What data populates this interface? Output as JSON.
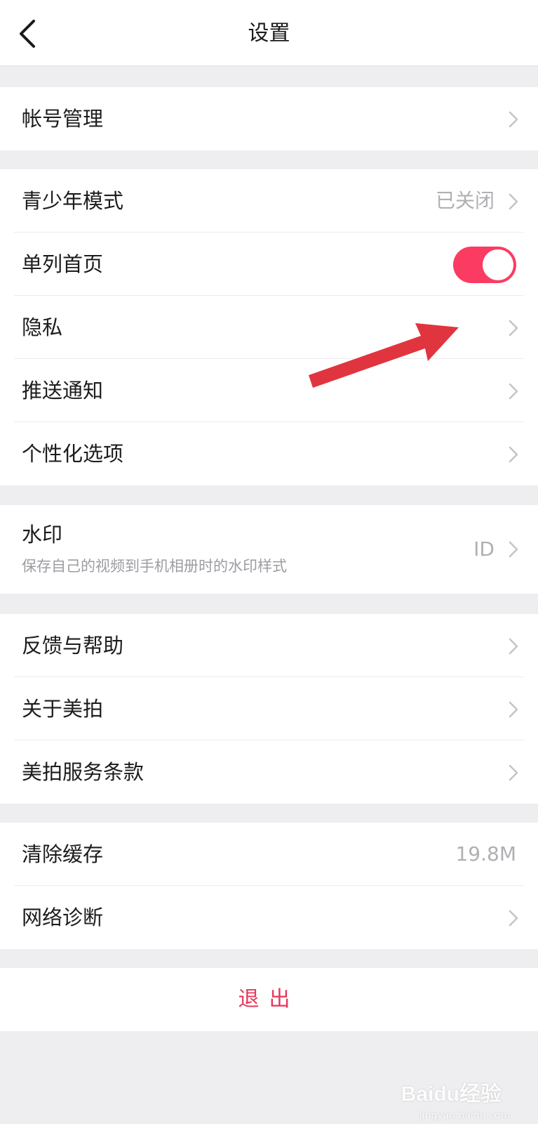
{
  "header": {
    "title": "设置",
    "back_icon": "chevron-left-icon"
  },
  "groups": [
    {
      "rows": [
        {
          "label": "帐号管理",
          "trailing": "chevron"
        }
      ]
    },
    {
      "rows": [
        {
          "label": "青少年模式",
          "value": "已关闭",
          "trailing": "chevron"
        },
        {
          "label": "单列首页",
          "trailing": "toggle",
          "toggle_on": true
        },
        {
          "label": "隐私",
          "trailing": "chevron"
        },
        {
          "label": "推送通知",
          "trailing": "chevron"
        },
        {
          "label": "个性化选项",
          "trailing": "chevron"
        }
      ]
    },
    {
      "watermark": {
        "label": "水印",
        "subtitle": "保存自己的视频到手机相册时的水印样式",
        "value": "ID",
        "trailing": "chevron"
      }
    },
    {
      "rows": [
        {
          "label": "反馈与帮助",
          "trailing": "chevron"
        },
        {
          "label": "关于美拍",
          "trailing": "chevron"
        },
        {
          "label": "美拍服务条款",
          "trailing": "chevron"
        }
      ]
    },
    {
      "rows": [
        {
          "label": "清除缓存",
          "value": "19.8M",
          "trailing": "none"
        },
        {
          "label": "网络诊断",
          "trailing": "chevron"
        }
      ]
    }
  ],
  "logout": {
    "label": "退出"
  },
  "watermark_overlay": {
    "logo": "Baidu经验",
    "url": "jingyan.baidu.com"
  },
  "colors": {
    "accent": "#fc3b62",
    "logout_text": "#e8365b",
    "background": "#eeeef0",
    "annotation_arrow": "#e0353f"
  }
}
